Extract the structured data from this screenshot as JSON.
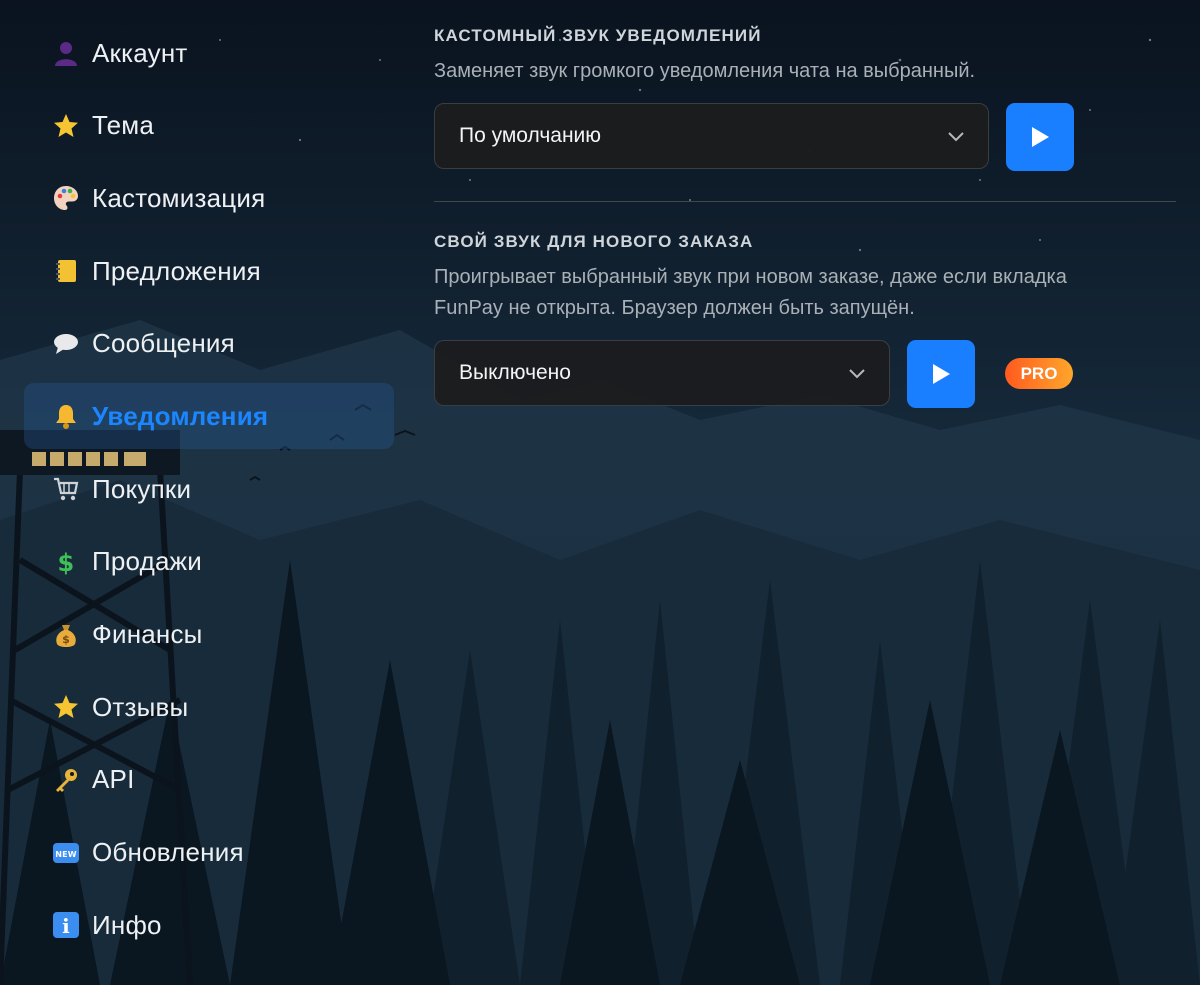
{
  "sidebar": {
    "items": [
      {
        "label": "Аккаунт",
        "icon": "user-silhouette-icon",
        "active": false
      },
      {
        "label": "Тема",
        "icon": "star-icon",
        "active": false
      },
      {
        "label": "Кастомизация",
        "icon": "palette-icon",
        "active": false
      },
      {
        "label": "Предложения",
        "icon": "notebook-icon",
        "active": false
      },
      {
        "label": "Сообщения",
        "icon": "speech-bubble-icon",
        "active": false
      },
      {
        "label": "Уведомления",
        "icon": "bell-icon",
        "active": true
      },
      {
        "label": "Покупки",
        "icon": "shopping-cart-icon",
        "active": false
      },
      {
        "label": "Продажи",
        "icon": "dollar-sign-icon",
        "active": false
      },
      {
        "label": "Финансы",
        "icon": "money-bag-icon",
        "active": false
      },
      {
        "label": "Отзывы",
        "icon": "star-icon",
        "active": false
      },
      {
        "label": "API",
        "icon": "key-icon",
        "active": false
      },
      {
        "label": "Обновления",
        "icon": "new-badge-icon",
        "active": false
      },
      {
        "label": "Инфо",
        "icon": "info-icon",
        "active": false
      }
    ]
  },
  "sections": {
    "custom_sound": {
      "title": "КАСТОМНЫЙ ЗВУК УВЕДОМЛЕНИЙ",
      "description": "Заменяет звук громкого уведомления чата на выбранный.",
      "select_value": "По умолчанию"
    },
    "order_sound": {
      "title": "СВОЙ ЗВУК ДЛЯ НОВОГО ЗАКАЗА",
      "description_line1": "Проигрывает выбранный звук при новом заказе, даже если вкладка",
      "description_line2": "FunPay не открыта. Браузер должен быть запущён.",
      "select_value": "Выключено",
      "badge": "PRO"
    }
  },
  "colors": {
    "accent": "#1a7fff",
    "active_text": "#1c86ff",
    "pro_gradient_start": "#ff5a1f",
    "pro_gradient_end": "#ffa62b"
  }
}
